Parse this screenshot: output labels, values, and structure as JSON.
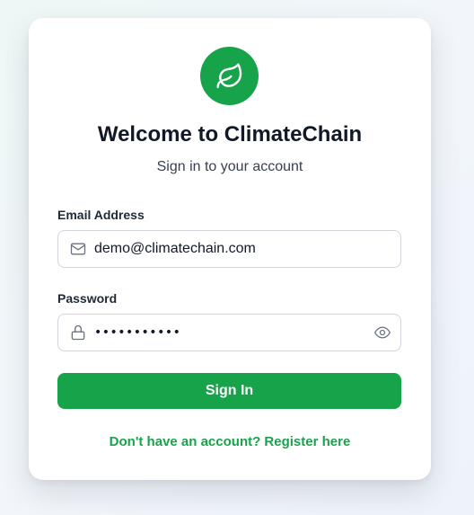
{
  "colors": {
    "accent": "#16a34a",
    "title": "#111827",
    "background": "#eef5f8"
  },
  "logo": {
    "icon": "leaf-icon"
  },
  "header": {
    "title": "Welcome to ClimateChain",
    "subtitle": "Sign in to your account"
  },
  "form": {
    "email": {
      "label": "Email Address",
      "value": "demo@climatechain.com",
      "icon": "mail-icon"
    },
    "password": {
      "label": "Password",
      "value": "•••••••••••",
      "icon": "lock-icon",
      "toggle_icon": "eye-icon"
    },
    "submit_label": "Sign In"
  },
  "footer": {
    "register_text": "Don't have an account? Register here"
  }
}
